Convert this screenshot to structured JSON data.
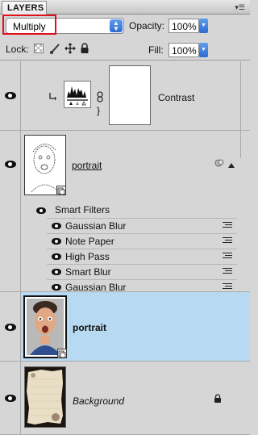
{
  "panel": {
    "tab_title": "LAYERS",
    "menu_icon": "panel-menu-icon"
  },
  "options": {
    "blend_mode": "Multiply",
    "opacity_label": "Opacity:",
    "opacity_value": "100%",
    "lock_label": "Lock:",
    "lock_icons": [
      "lock-transparent-icon",
      "lock-image-icon",
      "lock-position-icon",
      "lock-all-icon"
    ],
    "fill_label": "Fill:",
    "fill_value": "100%"
  },
  "layers": [
    {
      "name": "Contrast",
      "type": "adjustment",
      "visible": true,
      "clipped": true,
      "linked_mask": true
    },
    {
      "name": "portrait",
      "type": "smart-object",
      "visible": true,
      "underlined": true
    },
    {
      "name": "portrait",
      "type": "smart-object",
      "visible": true,
      "selected": true,
      "bold": true
    },
    {
      "name": "Background",
      "type": "background",
      "visible": true,
      "italic": true,
      "locked": true
    }
  ],
  "smart_filters": {
    "label": "Smart Filters",
    "items": [
      {
        "name": "Gaussian Blur"
      },
      {
        "name": "Note Paper"
      },
      {
        "name": "High Pass"
      },
      {
        "name": "Smart Blur"
      },
      {
        "name": "Gaussian Blur"
      }
    ]
  },
  "colors": {
    "selection": "#b7d9f1",
    "highlight_box": "#e0101a",
    "accent": "#2d6cd0"
  }
}
